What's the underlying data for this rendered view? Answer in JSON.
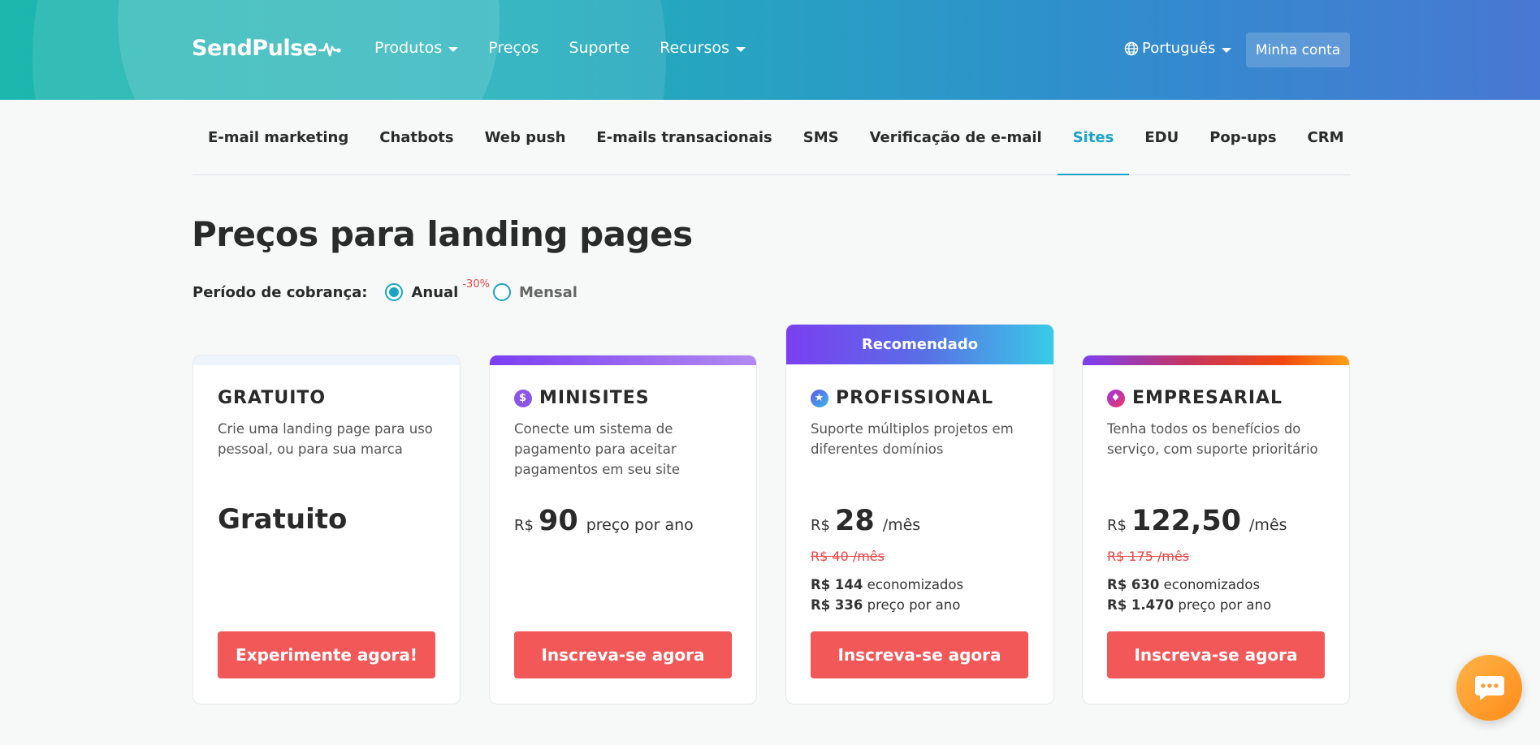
{
  "header": {
    "logo": "SendPulse",
    "nav": [
      {
        "label": "Produtos",
        "dropdown": true
      },
      {
        "label": "Preços",
        "dropdown": false
      },
      {
        "label": "Suporte",
        "dropdown": false
      },
      {
        "label": "Recursos",
        "dropdown": true
      }
    ],
    "language": "Português",
    "account_button": "Minha conta"
  },
  "tabs": {
    "items": [
      "E-mail marketing",
      "Chatbots",
      "Web push",
      "E-mails transacionais",
      "SMS",
      "Verificação de e-mail",
      "Sites",
      "EDU",
      "Pop-ups",
      "CRM"
    ],
    "active": "Sites"
  },
  "page_title": "Preços para landing pages",
  "billing": {
    "label": "Período de cobrança:",
    "annual": "Anual",
    "discount": "-30%",
    "monthly": "Mensal",
    "selected": "Anual"
  },
  "plans": {
    "free": {
      "name": "GRATUITO",
      "description": "Crie uma landing page para uso pessoal, ou para sua marca",
      "price_text": "Gratuito",
      "cta": "Experimente agora!"
    },
    "mini": {
      "name": "MINISITES",
      "icon": "dollar-icon",
      "description": "Conecte um sistema de pagamento para aceitar pagamentos em seu site",
      "currency": "R$",
      "amount": "90",
      "period": "preço por ano",
      "cta": "Inscreva-se agora"
    },
    "pro": {
      "badge": "Recomendado",
      "name": "PROFISSIONAL",
      "icon": "star-icon",
      "description": "Suporte múltiplos projetos em diferentes domínios",
      "currency": "R$",
      "amount": "28",
      "period": "/mês",
      "old_price": "R$ 40 /mês",
      "saved_amount": "R$ 144",
      "saved_label": "economizados",
      "yearly_amount": "R$ 336",
      "yearly_label": "preço por ano",
      "cta": "Inscreva-se agora"
    },
    "business": {
      "name": "EMPRESARIAL",
      "icon": "diamond-icon",
      "description": "Tenha todos os benefícios do serviço, com suporte prioritário",
      "currency": "R$",
      "amount": "122,50",
      "period": "/mês",
      "old_price": "R$ 175 /mês",
      "saved_amount": "R$ 630",
      "saved_label": "economizados",
      "yearly_amount": "R$ 1.470",
      "yearly_label": "preço por ano",
      "cta": "Inscreva-se agora"
    }
  },
  "colors": {
    "accent": "#1ba3c6",
    "cta": "#f25858",
    "strike": "#e84545",
    "chat": "#ff9a2e"
  }
}
